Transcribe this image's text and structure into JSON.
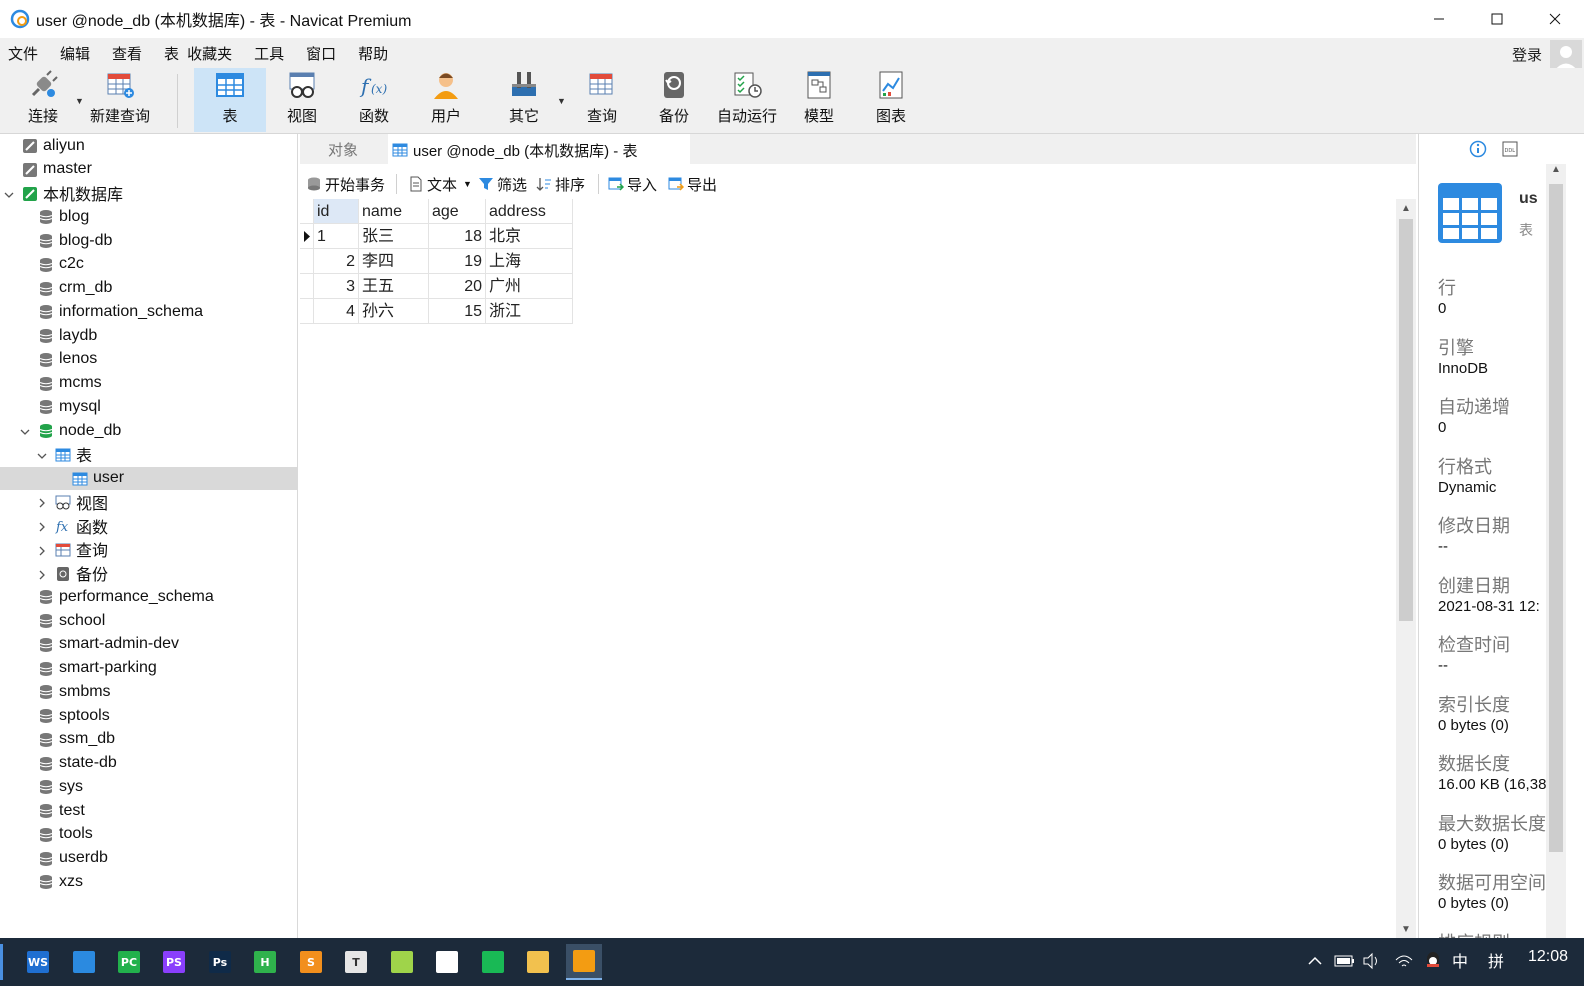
{
  "window": {
    "title": "user @node_db (本机数据库) - 表 - Navicat Premium"
  },
  "menu": [
    "文件",
    "编辑",
    "查看",
    "表",
    "收藏夹",
    "工具",
    "窗口",
    "帮助"
  ],
  "account": {
    "login_label": "登录"
  },
  "toolbar": [
    {
      "label": "连接",
      "icon": "plug-icon"
    },
    {
      "label": "新建查询",
      "icon": "new-query-icon"
    },
    {
      "label": "表",
      "icon": "table-icon"
    },
    {
      "label": "视图",
      "icon": "view-icon"
    },
    {
      "label": "函数",
      "icon": "function-icon"
    },
    {
      "label": "用户",
      "icon": "user-icon"
    },
    {
      "label": "其它",
      "icon": "tools-icon"
    },
    {
      "label": "查询",
      "icon": "query-icon"
    },
    {
      "label": "备份",
      "icon": "backup-icon"
    },
    {
      "label": "自动运行",
      "icon": "schedule-icon"
    },
    {
      "label": "模型",
      "icon": "model-icon"
    },
    {
      "label": "图表",
      "icon": "chart-icon"
    }
  ],
  "sidebar": {
    "connections": [
      "aliyun",
      "master"
    ],
    "local_connection": "本机数据库",
    "databases_before": [
      "blog",
      "blog-db",
      "c2c",
      "crm_db",
      "information_schema",
      "laydb",
      "lenos",
      "mcms",
      "mysql"
    ],
    "open_db": "node_db",
    "tables_folder": "表",
    "table": "user",
    "folders": [
      "视图",
      "函数",
      "查询",
      "备份"
    ],
    "databases_after": [
      "performance_schema",
      "school",
      "smart-admin-dev",
      "smart-parking",
      "smbms",
      "sptools",
      "ssm_db",
      "state-db",
      "sys",
      "test",
      "tools",
      "userdb",
      "xzs"
    ]
  },
  "tabs": {
    "objects": "对象",
    "active": "user @node_db (本机数据库) - 表"
  },
  "subtoolbar": {
    "begin_tx": "开始事务",
    "text": "文本",
    "filter": "筛选",
    "sort": "排序",
    "import": "导入",
    "export": "导出"
  },
  "grid": {
    "columns": [
      "id",
      "name",
      "age",
      "address"
    ],
    "rows": [
      [
        "1",
        "张三",
        "18",
        "北京"
      ],
      [
        "2",
        "李四",
        "19",
        "上海"
      ],
      [
        "3",
        "王五",
        "20",
        "广州"
      ],
      [
        "4",
        "孙六",
        "15",
        "浙江"
      ]
    ]
  },
  "properties": {
    "object_name": "us",
    "object_type": "表",
    "items": [
      {
        "label": "行",
        "value": "0"
      },
      {
        "label": "引擎",
        "value": "InnoDB"
      },
      {
        "label": "自动递增",
        "value": "0"
      },
      {
        "label": "行格式",
        "value": "Dynamic"
      },
      {
        "label": "修改日期",
        "value": "--"
      },
      {
        "label": "创建日期",
        "value": "2021-08-31 12:"
      },
      {
        "label": "检查时间",
        "value": "--"
      },
      {
        "label": "索引长度",
        "value": "0 bytes (0)"
      },
      {
        "label": "数据长度",
        "value": "16.00 KB (16,38"
      },
      {
        "label": "最大数据长度",
        "value": "0 bytes (0)"
      },
      {
        "label": "数据可用空间",
        "value": "0 bytes (0)"
      },
      {
        "label": "排序规则",
        "value": ""
      }
    ]
  },
  "taskbar": {
    "apps": [
      {
        "name": "wps",
        "text": "WS",
        "color": "#1f6fd1"
      },
      {
        "name": "vscode",
        "text": "",
        "color": "#2b8ae0"
      },
      {
        "name": "pycharm",
        "text": "PC",
        "color": "#22b14c"
      },
      {
        "name": "phpstorm",
        "text": "PS",
        "color": "#8a3ffc"
      },
      {
        "name": "photoshop",
        "text": "Ps",
        "color": "#0f2a48"
      },
      {
        "name": "hbuilder",
        "text": "H",
        "color": "#2fb24c"
      },
      {
        "name": "sublime",
        "text": "S",
        "color": "#f28f1d"
      },
      {
        "name": "typora",
        "text": "T",
        "color": "#e6e6e6"
      },
      {
        "name": "notepad",
        "text": "",
        "color": "#9fd44a"
      },
      {
        "name": "wechat",
        "text": "",
        "color": "#ffffff"
      },
      {
        "name": "cortana",
        "text": "",
        "color": "#19b955"
      },
      {
        "name": "explorer",
        "text": "",
        "color": "#f2c14e"
      },
      {
        "name": "navicat",
        "text": "",
        "color": "#f39c12"
      }
    ],
    "ime": "中",
    "ime2": "拼",
    "clock": "12:08"
  },
  "colors": {
    "accent": "#2d8ae0",
    "selection": "#cde4f7",
    "taskbar": "#1c2a3a"
  }
}
